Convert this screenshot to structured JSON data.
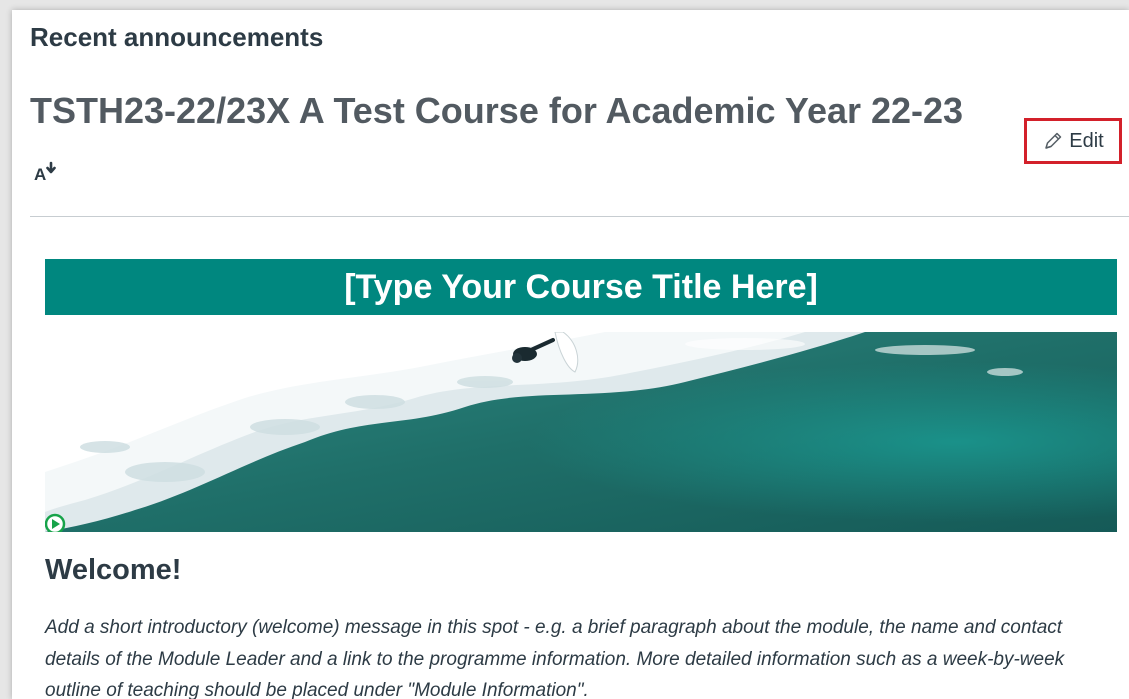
{
  "header": {
    "recent_announcements": "Recent announcements",
    "course_title": "TSTH23-22/23X A Test Course for Academic Year 22-23",
    "edit_label": "Edit"
  },
  "icons": {
    "immersive_reader": "immersive-reader-icon",
    "edit": "pencil-icon",
    "play": "play-icon"
  },
  "content": {
    "banner_title": "[Type Your Course Title Here]",
    "welcome_heading": "Welcome!",
    "intro_text": "Add a short introductory (welcome) message in this spot - e.g.  a brief paragraph about the module, the name and contact details of the Module Leader and a link to the programme information. More detailed information such as a week-by-week outline of teaching should be placed under \"Module Information\"."
  },
  "colors": {
    "banner_bg": "#00877f",
    "edit_highlight": "#d3202a",
    "heading_text": "#2d3b45",
    "title_text": "#525a61"
  }
}
